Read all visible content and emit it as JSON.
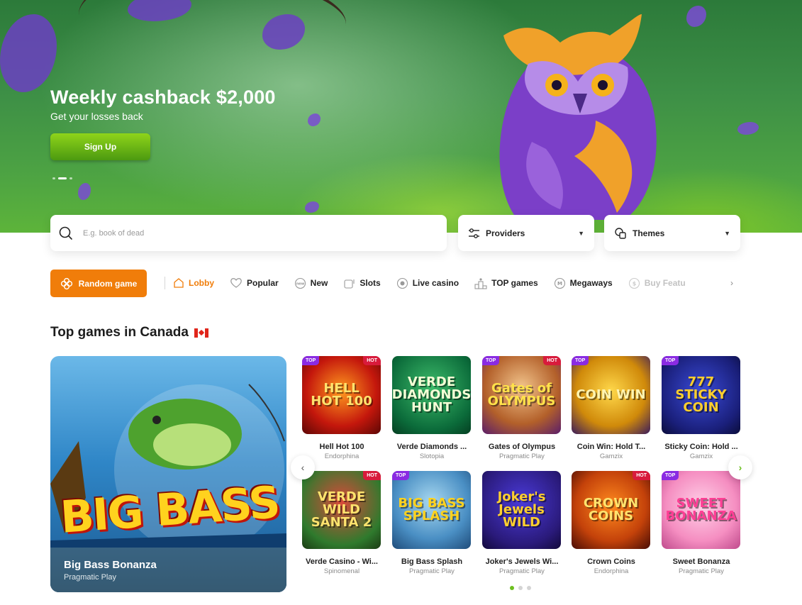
{
  "hero": {
    "title": "Weekly cashback $2,000",
    "subtitle": "Get your losses back",
    "cta_label": "Sign Up",
    "slide_count": 3,
    "active_slide": 2
  },
  "search": {
    "placeholder": "E.g. book of dead",
    "providers_label": "Providers",
    "themes_label": "Themes"
  },
  "nav": {
    "random_label": "Random game",
    "items": [
      {
        "label": "Lobby",
        "icon": "home-icon"
      },
      {
        "label": "Popular",
        "icon": "heart-icon"
      },
      {
        "label": "New",
        "icon": "new-badge-icon"
      },
      {
        "label": "Slots",
        "icon": "slot-icon"
      },
      {
        "label": "Live casino",
        "icon": "live-icon"
      },
      {
        "label": "TOP games",
        "icon": "podium-icon"
      },
      {
        "label": "Megaways",
        "icon": "megaways-icon"
      },
      {
        "label": "Buy Featu",
        "icon": "coin-icon"
      }
    ],
    "active_item": "Lobby"
  },
  "section": {
    "title": "Top games in Canada"
  },
  "featured": {
    "art_text": "BIG BASS",
    "name": "Big Bass Bonanza",
    "provider": "Pragmatic Play"
  },
  "games": [
    {
      "name": "Hell Hot 100",
      "provider": "Endorphina",
      "art": "HELL HOT 100",
      "top": "TOP",
      "hot": "HOT"
    },
    {
      "name": "Verde Diamonds ...",
      "provider": "Slotopia",
      "art": "VERDE DIAMONDS HUNT",
      "top": "",
      "hot": ""
    },
    {
      "name": "Gates of Olympus",
      "provider": "Pragmatic Play",
      "art": "Gates of OLYMPUS",
      "top": "TOP",
      "hot": "HOT"
    },
    {
      "name": "Coin Win: Hold T...",
      "provider": "Gamzix",
      "art": "COIN WIN",
      "top": "TOP",
      "hot": ""
    },
    {
      "name": "Sticky Coin: Hold ...",
      "provider": "Gamzix",
      "art": "777 STICKY COIN",
      "top": "TOP",
      "hot": ""
    },
    {
      "name": "Verde Casino - Wi...",
      "provider": "Spinomenal",
      "art": "VERDE WILD SANTA 2",
      "top": "",
      "hot": "HOT"
    },
    {
      "name": "Big Bass Splash",
      "provider": "Pragmatic Play",
      "art": "BIG BASS SPLASH",
      "top": "TOP",
      "hot": ""
    },
    {
      "name": "Joker's Jewels Wi...",
      "provider": "Pragmatic Play",
      "art": "Joker's Jewels WILD",
      "top": "",
      "hot": ""
    },
    {
      "name": "Crown Coins",
      "provider": "Endorphina",
      "art": "CROWN COINS",
      "top": "",
      "hot": "HOT"
    },
    {
      "name": "Sweet Bonanza",
      "provider": "Pragmatic Play",
      "art": "SWEET BONANZA",
      "top": "TOP",
      "hot": ""
    }
  ],
  "pager": {
    "count": 3,
    "active": 1
  },
  "colors": {
    "accent_orange": "#f07d0a",
    "accent_green": "#6cbf1f",
    "top_badge": "#8a2be2",
    "hot_badge": "#d81b3c"
  }
}
